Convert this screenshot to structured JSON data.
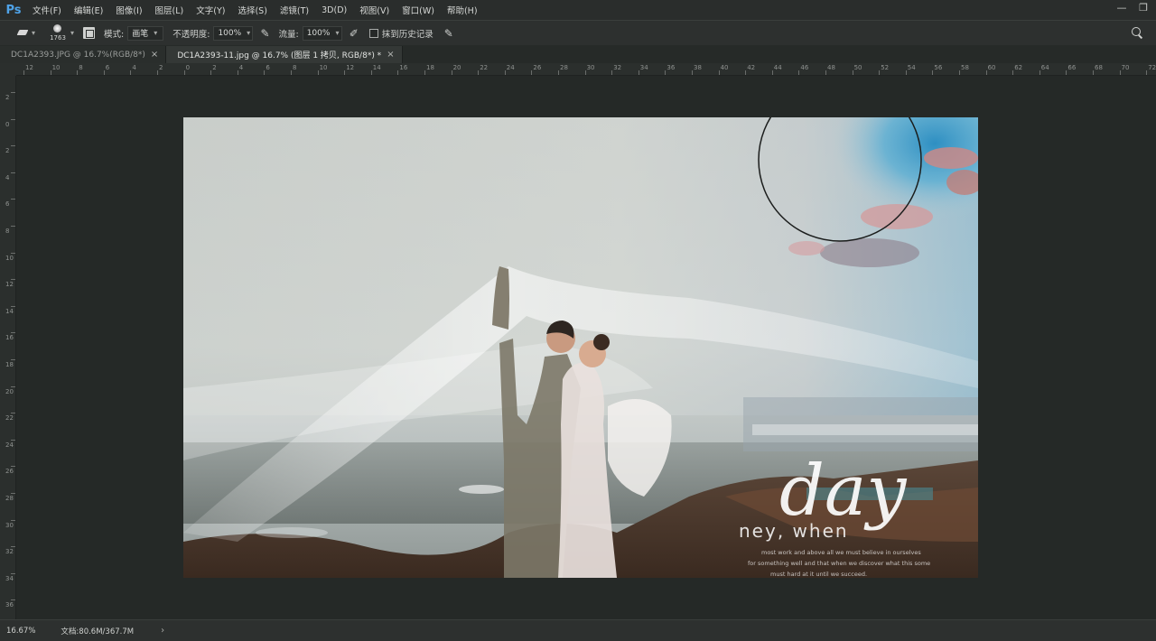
{
  "app": {
    "logo": "Ps"
  },
  "menu": [
    "文件(F)",
    "编辑(E)",
    "图像(I)",
    "图层(L)",
    "文字(Y)",
    "选择(S)",
    "滤镜(T)",
    "3D(D)",
    "视图(V)",
    "窗口(W)",
    "帮助(H)"
  ],
  "window_controls": {
    "minimize": "—",
    "restore": "❐"
  },
  "options": {
    "brush_size": "1763",
    "mode_label": "模式:",
    "mode_value": "画笔",
    "opacity_label": "不透明度:",
    "opacity_value": "100%",
    "flow_label": "流量:",
    "flow_value": "100%",
    "erase_history_label": "抹到历史记录"
  },
  "tabs": [
    {
      "label": "DC1A2393.JPG @ 16.7%(RGB/8*)",
      "close": "×",
      "active": false
    },
    {
      "label": "DC1A2393-11.jpg @ 16.7% (图层 1 拷贝, RGB/8*) *",
      "close": "×",
      "active": true
    }
  ],
  "ruler_top": [
    "12",
    "10",
    "8",
    "6",
    "4",
    "2",
    "0",
    "2",
    "4",
    "6",
    "8",
    "10",
    "12",
    "14",
    "16",
    "18",
    "20",
    "22",
    "24",
    "26",
    "28",
    "30",
    "32",
    "34",
    "36",
    "38",
    "40",
    "42",
    "44",
    "46",
    "48",
    "50",
    "52",
    "54",
    "56",
    "58",
    "60",
    "62",
    "64",
    "66",
    "68",
    "70",
    "72",
    "74",
    "76",
    "78"
  ],
  "ruler_left": [
    "2",
    "0",
    "2",
    "4",
    "6",
    "8",
    "10",
    "12",
    "14",
    "16",
    "18",
    "20",
    "22",
    "24",
    "26",
    "28",
    "30",
    "32",
    "34",
    "36"
  ],
  "photo": {
    "script_text": "day",
    "overlay_line": "ney, when",
    "fine_print": [
      "most work and above all we must believe in ourselves",
      "for something well and that when we discover what this some",
      "must hard at it until we succeed."
    ]
  },
  "status": {
    "zoom": "16.67%",
    "doc": "文档:80.6M/367.7M",
    "arrow": "›"
  }
}
